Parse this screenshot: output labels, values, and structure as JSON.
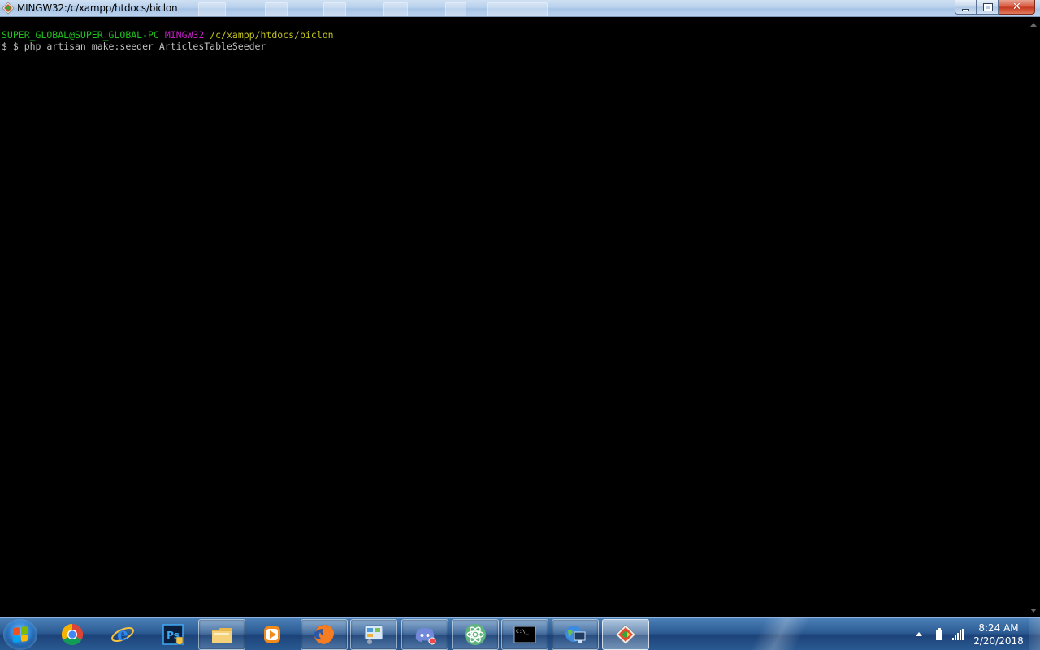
{
  "window": {
    "title": "MINGW32:/c/xampp/htdocs/biclon",
    "icon": "git-bash-icon",
    "buttons": {
      "minimize": "minimize-icon",
      "maximize": "restore-icon",
      "close": "close-icon"
    }
  },
  "terminal": {
    "prompt": {
      "user_host": "SUPER_GLOBAL@SUPER_GLOBAL-PC",
      "system": "MINGW32",
      "path": "/c/xampp/htdocs/biclon"
    },
    "command_line": "$ $ php artisan make:seeder ArticlesTableSeeder",
    "colors": {
      "user_host": "#1ec11e",
      "system": "#c31fc3",
      "path": "#c4c41d",
      "text": "#c0c0c0",
      "background": "#000000"
    }
  },
  "taskbar": {
    "start_icon": "windows-start-orb",
    "items": [
      {
        "icon": "chrome-icon",
        "state": "pinned"
      },
      {
        "icon": "internet-explorer-icon",
        "state": "pinned"
      },
      {
        "icon": "photoshop-icon",
        "label": "Ps",
        "state": "pinned"
      },
      {
        "icon": "file-explorer-icon",
        "state": "open"
      },
      {
        "icon": "media-player-icon",
        "state": "pinned"
      },
      {
        "icon": "firefox-icon",
        "state": "open"
      },
      {
        "icon": "control-panel-icon",
        "state": "open"
      },
      {
        "icon": "discord-icon",
        "state": "open"
      },
      {
        "icon": "atom-editor-icon",
        "state": "open"
      },
      {
        "icon": "command-prompt-icon",
        "label": "C:\\_",
        "state": "open"
      },
      {
        "icon": "network-computer-icon",
        "state": "open"
      },
      {
        "icon": "git-bash-icon",
        "state": "active"
      }
    ],
    "tray": {
      "icons": [
        "show-hidden-icons-arrow",
        "battery-icon",
        "signal-icon"
      ],
      "time": "8:24 AM",
      "date": "2/20/2018"
    }
  }
}
